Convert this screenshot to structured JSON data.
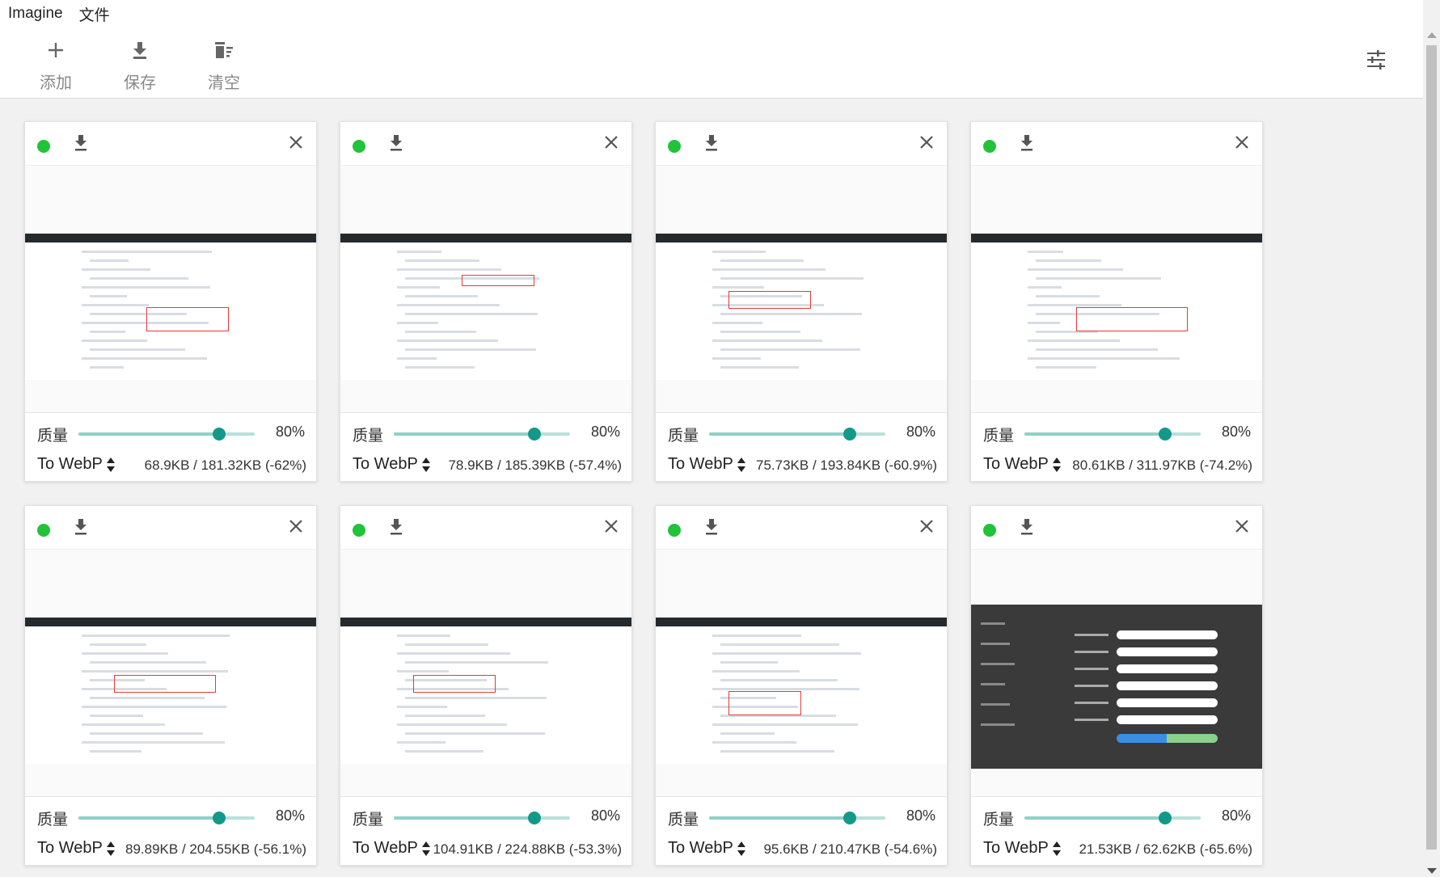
{
  "menu": {
    "app_name": "Imagine",
    "file_menu": "文件"
  },
  "toolbar": {
    "add_label": "添加",
    "save_label": "保存",
    "clear_label": "清空",
    "add_icon": "plus-icon",
    "save_icon": "download-icon",
    "clear_icon": "trash-icon",
    "settings_icon": "sliders-icon"
  },
  "colors": {
    "status_dot": "#21c33a",
    "slider_knob": "#12998a",
    "slider_track": "#b8e0d9"
  },
  "cards": [
    {
      "quality_label": "质量",
      "quality_value": "80%",
      "quality_percent": 80,
      "format": "To WebP",
      "size_info": "68.9KB / 181.32KB (-62%)",
      "preview": "github-repo"
    },
    {
      "quality_label": "质量",
      "quality_value": "80%",
      "quality_percent": 80,
      "format": "To WebP",
      "size_info": "78.9KB / 185.39KB (-57.4%)",
      "preview": "github-new-repo"
    },
    {
      "quality_label": "质量",
      "quality_value": "80%",
      "quality_percent": 80,
      "format": "To WebP",
      "size_info": "75.73KB / 193.84KB (-60.9%)",
      "preview": "github-repo-menu"
    },
    {
      "quality_label": "质量",
      "quality_value": "80%",
      "quality_percent": 80,
      "format": "To WebP",
      "size_info": "80.61KB / 311.97KB (-74.2%)",
      "preview": "github-profile"
    },
    {
      "quality_label": "质量",
      "quality_value": "80%",
      "quality_percent": 80,
      "format": "To WebP",
      "size_info": "89.89KB / 204.55KB (-56.1%)",
      "preview": "github-tokens"
    },
    {
      "quality_label": "质量",
      "quality_value": "80%",
      "quality_percent": 80,
      "format": "To WebP",
      "size_info": "104.91KB / 224.88KB (-53.3%)",
      "preview": "github-new-token"
    },
    {
      "quality_label": "质量",
      "quality_value": "80%",
      "quality_percent": 80,
      "format": "To WebP",
      "size_info": "95.6KB / 210.47KB (-54.6%)",
      "preview": "github-token-created"
    },
    {
      "quality_label": "质量",
      "quality_value": "80%",
      "quality_percent": 80,
      "format": "To WebP",
      "size_info": "21.53KB / 62.62KB (-65.6%)",
      "preview": "picgo-github-settings"
    }
  ]
}
